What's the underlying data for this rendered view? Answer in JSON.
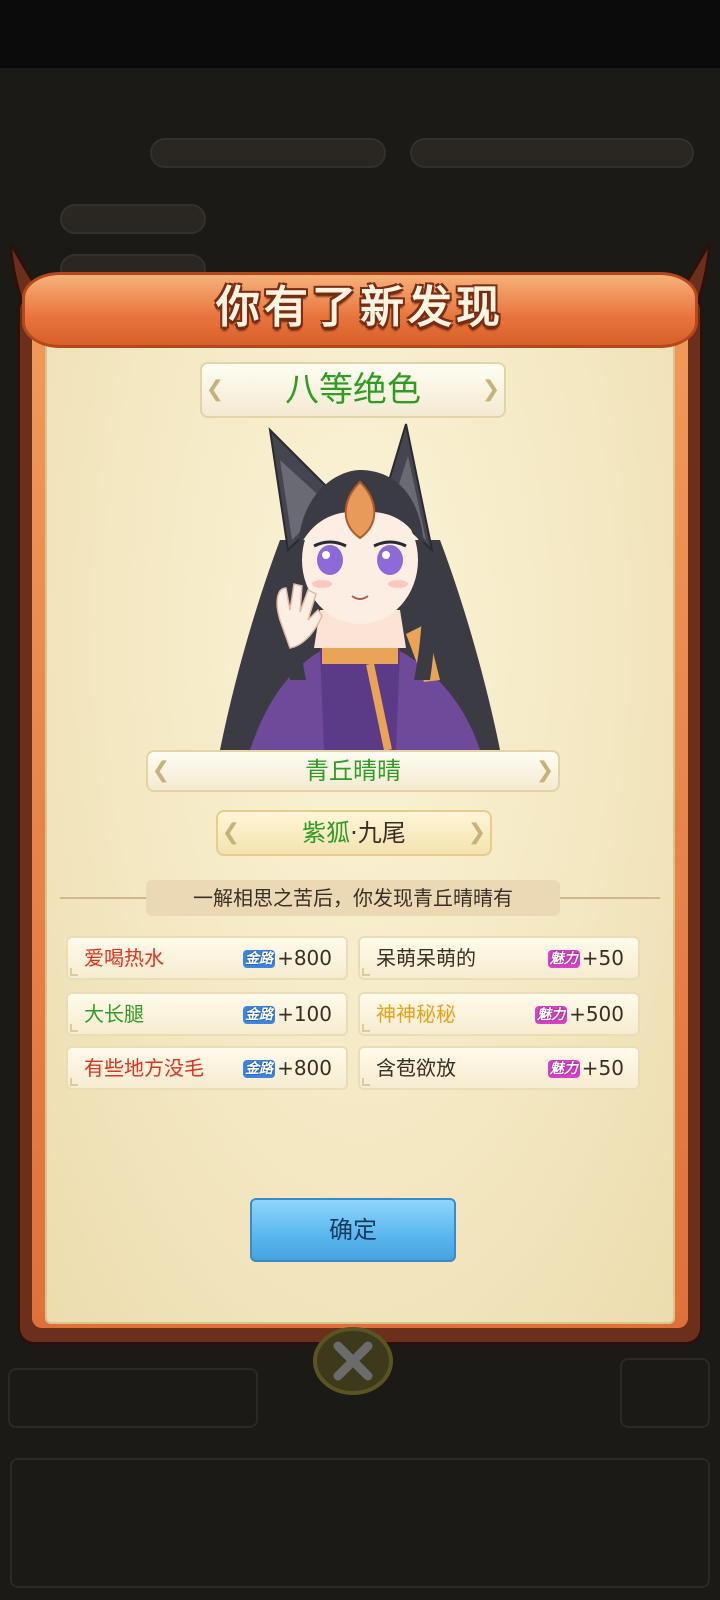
{
  "dialog": {
    "title": "你有了新发现",
    "rank": "八等绝色",
    "name": "青丘晴晴",
    "tag_green": "紫狐",
    "tag_black": "·九尾",
    "discover_text": "一解相思之苦后，你发现青丘晴晴有",
    "confirm_label": "确定"
  },
  "traits": [
    {
      "name": "爱喝热水",
      "name_color": "#e0321e",
      "badge": "金路",
      "badge_style": "blue",
      "value": "+800"
    },
    {
      "name": "呆萌呆萌的",
      "name_color": "#3a2f24",
      "badge": "魅力",
      "badge_style": "pink",
      "value": "+50"
    },
    {
      "name": "大长腿",
      "name_color": "#2f9c24",
      "badge": "金路",
      "badge_style": "blue",
      "value": "+100"
    },
    {
      "name": "神神秘秘",
      "name_color": "#e6a21a",
      "badge": "魅力",
      "badge_style": "pink",
      "value": "+500"
    },
    {
      "name": "有些地方没毛",
      "name_color": "#e0321e",
      "badge": "金路",
      "badge_style": "blue",
      "value": "+800"
    },
    {
      "name": "含苞欲放",
      "name_color": "#3a2f24",
      "badge": "魅力",
      "badge_style": "pink",
      "value": "+50"
    }
  ],
  "icons": {
    "close": "close-icon"
  }
}
